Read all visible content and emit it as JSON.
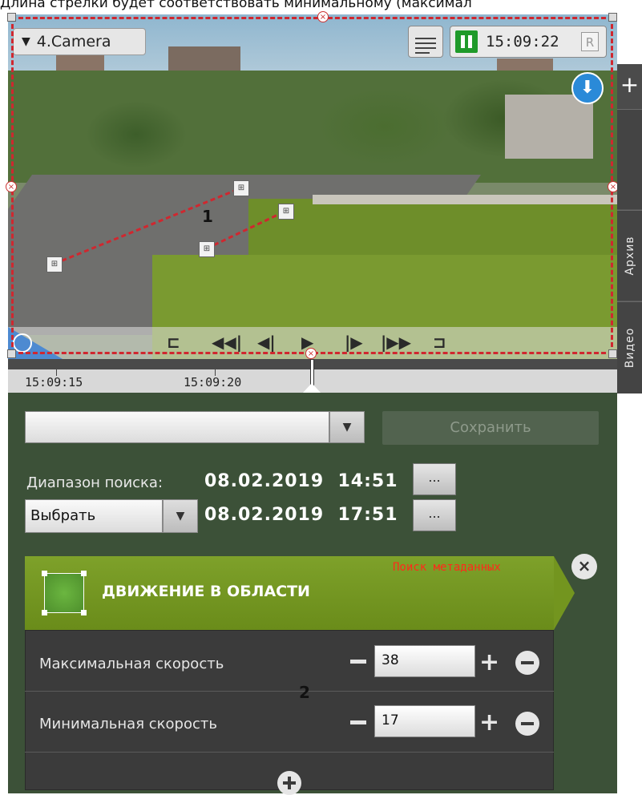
{
  "caption": "Длина стрелки будет соответствовать минимальному (максимал",
  "camera": {
    "label": "4.Camera"
  },
  "player": {
    "time": "15:09:22",
    "rec_label": "R"
  },
  "markers": {
    "zone": "1",
    "panel": "2"
  },
  "side_tabs": {
    "archive": "Архив",
    "video": "Видео"
  },
  "timeline": {
    "labels": [
      "15:09:15",
      "15:09:20"
    ]
  },
  "search": {
    "save_label": "Сохранить",
    "range_label": "Диапазон поиска:",
    "from_datetime": "08.02.2019  14:51",
    "to_datetime": "08.02.2019  17:51",
    "preset": "Выбрать",
    "dots_label": "..."
  },
  "filter": {
    "title": "ДВИЖЕНИЕ В ОБЛАСТИ",
    "tag": "Поиск метаданных",
    "params": [
      {
        "label": "Максимальная скорость",
        "value": "38"
      },
      {
        "label": "Минимальная скорость",
        "value": "17"
      }
    ]
  },
  "colors": {
    "accent_green": "#6a8c1a",
    "panel_bg": "#3c5138",
    "zone_red": "#d0272f",
    "tag_red": "#ff2a1a"
  }
}
